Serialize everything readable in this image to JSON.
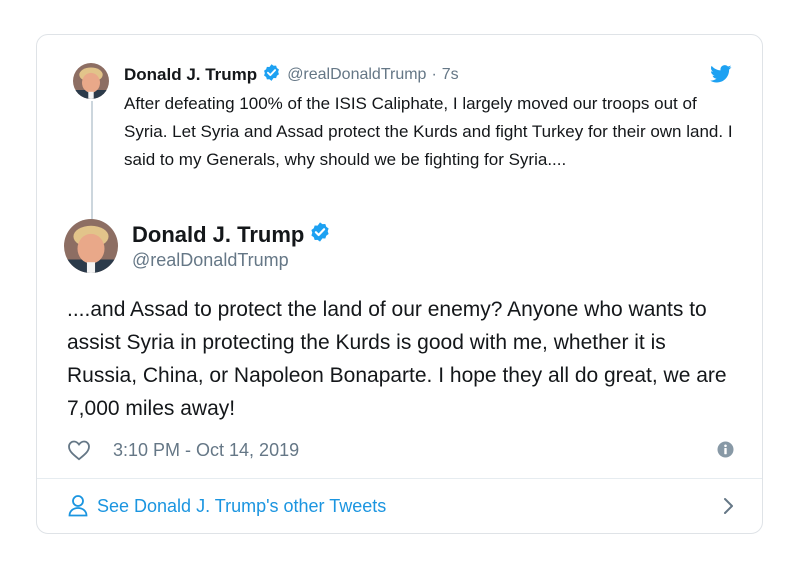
{
  "quoted_tweet": {
    "author_name": "Donald J. Trump",
    "handle": "@realDonaldTrump",
    "separator": "·",
    "time": "7s",
    "text": "After defeating 100% of the ISIS Caliphate, I largely moved our troops out of Syria. Let Syria and Assad protect the Kurds and fight Turkey for their own land. I said to my Generals, why should we be fighting for Syria...."
  },
  "main_tweet": {
    "author_name": "Donald J. Trump",
    "handle": "@realDonaldTrump",
    "text": "....and Assad to protect the land of our enemy? Anyone who wants to assist Syria in protecting the Kurds is good with me, whether it is Russia, China, or Napoleon Bonaparte. I hope they all do great, we are 7,000 miles away!",
    "timestamp": "3:10 PM - Oct 14, 2019"
  },
  "footer": {
    "link_label": "See Donald J. Trump's other Tweets"
  },
  "colors": {
    "text": "#14171a",
    "secondary": "#657786",
    "accent": "#1da1f2",
    "link": "#1b95e0",
    "border": "#dfe3e7"
  },
  "icons": [
    "verified-badge-icon",
    "twitter-bird-icon",
    "heart-icon",
    "info-icon",
    "person-icon",
    "chevron-right-icon"
  ]
}
